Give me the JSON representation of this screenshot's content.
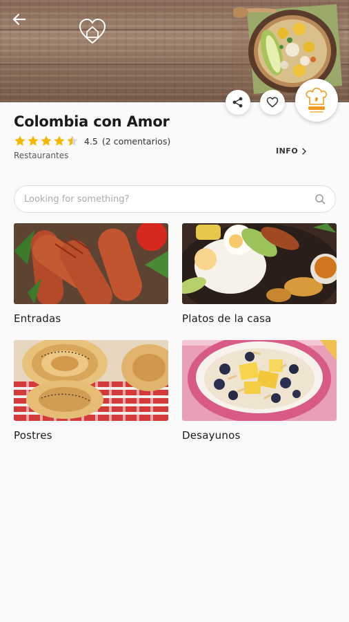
{
  "restaurant": {
    "name": "Colombia con Amor",
    "rating": "4.5",
    "reviews": "(2 comentarios)",
    "stars": 4.5,
    "category": "Restaurantes",
    "info_label": "INFO"
  },
  "search": {
    "placeholder": "Looking for something?"
  },
  "categories": [
    {
      "label": "Entradas"
    },
    {
      "label": "Platos de la casa"
    },
    {
      "label": "Postres"
    },
    {
      "label": "Desayunos"
    }
  ],
  "colors": {
    "star": "#f5b800",
    "accent": "#f39a1e",
    "text": "#1b1b1b"
  },
  "icons": [
    "back-arrow-icon",
    "heart-home-logo",
    "share-icon",
    "heart-icon",
    "chef-hat-badge",
    "star-icon",
    "chevron-right-icon",
    "search-icon"
  ]
}
